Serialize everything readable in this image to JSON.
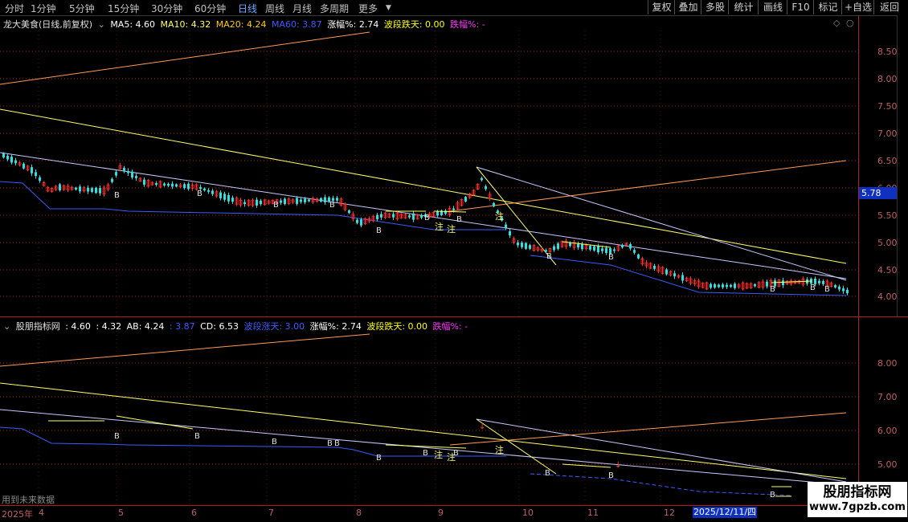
{
  "toolbar": {
    "periods": [
      "分时",
      "1分钟",
      "5分钟",
      "15分钟",
      "30分钟",
      "60分钟",
      "日线",
      "周线",
      "月线",
      "多周期",
      "更多"
    ],
    "active_period": "日线",
    "buttons": [
      "复权",
      "叠加",
      "多股",
      "统计",
      "画线",
      "F10",
      "标记",
      "+自选",
      "返回"
    ]
  },
  "main_panel": {
    "title": "龙大美食(日线,前复权)",
    "legend": [
      {
        "label": "MA5: 4.60",
        "color": "#ffffff"
      },
      {
        "label": "MA10: 4.32",
        "color": "#ffff66"
      },
      {
        "label": "MA20: 4.24",
        "color": "#ffcc00"
      },
      {
        "label": "MA60: 3.87",
        "color": "#3b5bff"
      },
      {
        "label": "涨幅%: 2.74",
        "color": "#ffffff"
      },
      {
        "label": "波段跌天: 0.00",
        "color": "#ffff00"
      },
      {
        "label": "跌幅%: -",
        "color": "#ff33ff"
      }
    ],
    "y_ticks": [
      "8.50",
      "8.00",
      "7.50",
      "7.00",
      "6.50",
      "6.00",
      "5.50",
      "5.00",
      "4.50",
      "4.00"
    ],
    "current_price": "5.78"
  },
  "sub_panel": {
    "title": "股朋指标网",
    "legend": [
      {
        "label": ": 4.60",
        "color": "#ffffff"
      },
      {
        "label": ": 4.32",
        "color": "#ffffff"
      },
      {
        "label": "AB: 4.24",
        "color": "#ffffff"
      },
      {
        "label": ": 3.87",
        "color": "#3b5bff"
      },
      {
        "label": "CD: 6.53",
        "color": "#ffffff"
      },
      {
        "label": "波段涨天: 3.00",
        "color": "#3b5bff"
      },
      {
        "label": "涨幅%: 2.74",
        "color": "#ffffff"
      },
      {
        "label": "波段跌天: 0.00",
        "color": "#ffff00"
      },
      {
        "label": "跌幅%: -",
        "color": "#ff33ff"
      }
    ],
    "y_ticks": [
      "8.00",
      "7.00",
      "6.00",
      "5.00"
    ],
    "footer_note": "用到未来数据"
  },
  "x_axis": {
    "labels": [
      "2025年",
      "4",
      "5",
      "6",
      "7",
      "8",
      "9",
      "10",
      "11",
      "12"
    ],
    "cursor_date": "2025/12/11/四"
  },
  "watermark": {
    "line1": "股朋指标网",
    "line2": "www.7gpzb.com"
  },
  "colors": {
    "up": "#ff3030",
    "down": "#30e0e0",
    "grid": "#b02020",
    "axis_text": "#c06060"
  }
}
